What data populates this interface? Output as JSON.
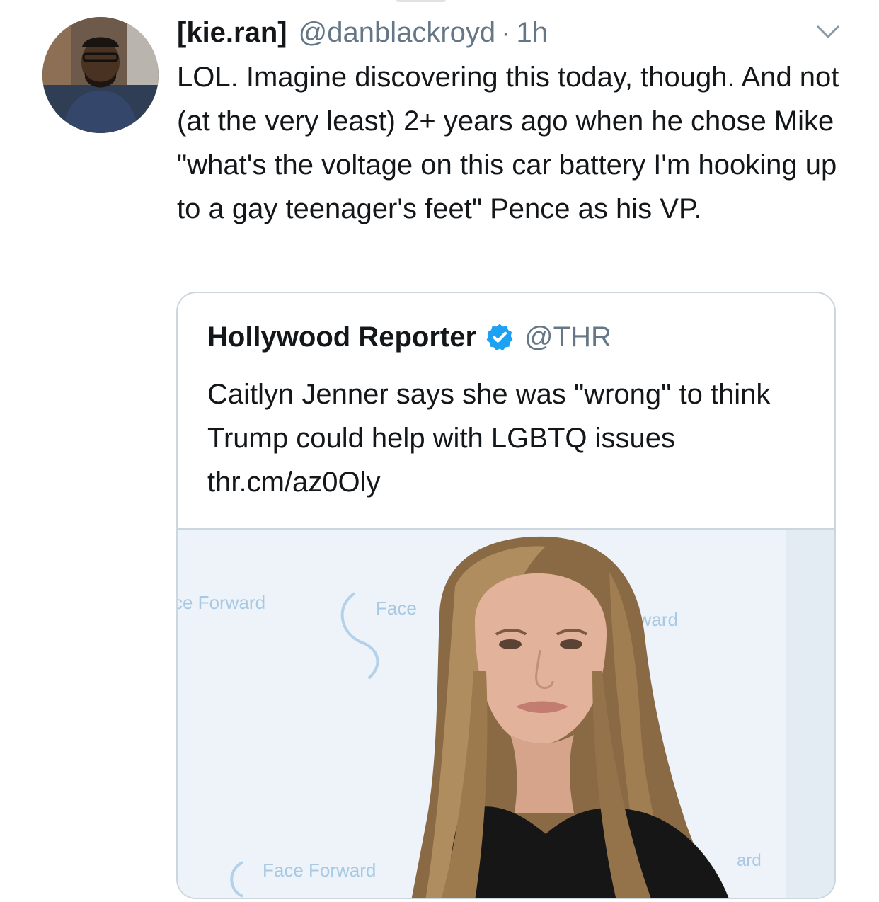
{
  "tweet": {
    "display_name": "[kie.ran]",
    "handle": "@danblackroyd",
    "separator": "·",
    "time": "1h",
    "text": "LOL. Imagine discovering this today, though. And not (at the very least) 2+ years ago when he chose Mike \"what's the voltage on this car battery I'm hooking up to a gay teenager's feet\" Pence as his VP."
  },
  "quoted_tweet": {
    "display_name": "Hollywood Reporter",
    "handle": "@THR",
    "verified": true,
    "text": "Caitlyn Jenner says she was \"wrong\" to think Trump could help with LGBTQ issues thr.cm/az0Oly",
    "media": {
      "backdrop_texts": [
        "ce Forward",
        "Face",
        "e Forward",
        "Face Forward",
        "ard"
      ]
    }
  },
  "colors": {
    "text_primary": "#14171a",
    "text_secondary": "#657786",
    "border": "#ccd6dd",
    "verified_blue": "#1da1f2",
    "backdrop_logo": "#9cc3e2"
  },
  "icons": {
    "avatar": "user-avatar",
    "caret": "chevron-down-icon",
    "verified": "verified-badge-icon"
  }
}
